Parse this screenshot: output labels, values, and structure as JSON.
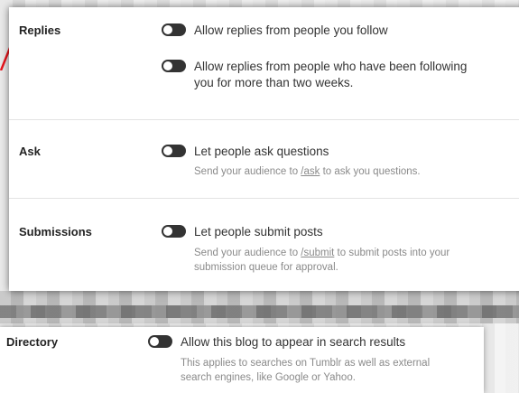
{
  "replies": {
    "label": "Replies",
    "opt1": "Allow replies from people you follow",
    "opt2_line1": "Allow replies from people who have been following",
    "opt2_line2": "you for more than two weeks."
  },
  "ask": {
    "label": "Ask",
    "option": "Let people ask questions",
    "help_prefix": "Send your audience to ",
    "help_link": "/ask",
    "help_suffix": " to ask you questions."
  },
  "submissions": {
    "label": "Submissions",
    "option": "Let people submit posts",
    "help_prefix": "Send your audience to ",
    "help_link": "/submit",
    "help_suffix": " to submit posts into your",
    "help_line2": "submission queue for approval."
  },
  "directory": {
    "label": "Directory",
    "option": "Allow this blog to appear in search results",
    "help_line1": "This applies to searches on Tumblr as well as external",
    "help_line2": "search engines, like Google or Yahoo."
  },
  "colors": {
    "toggle_off": "#333333",
    "arrow": "#e8141c"
  }
}
